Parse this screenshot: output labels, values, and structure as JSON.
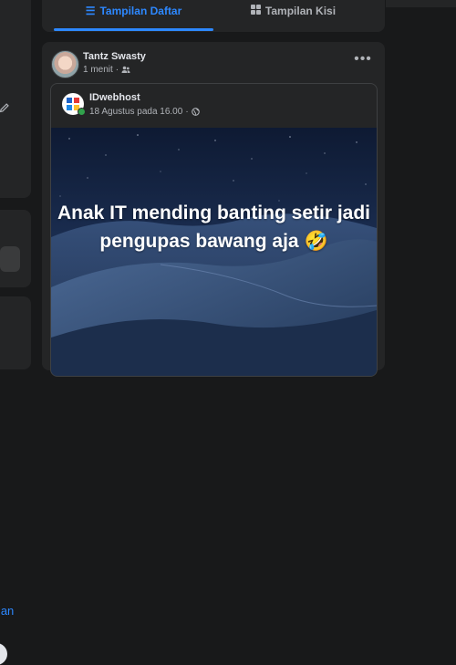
{
  "tabs": {
    "list_view": "Tampilan Daftar",
    "grid_view": "Tampilan Kisi"
  },
  "sidebar": {
    "partial_link": "man"
  },
  "post": {
    "author": "Tantz Swasty",
    "time": "1 menit",
    "privacy_icon": "friends-icon",
    "more_icon": "more-options-icon",
    "shared": {
      "page_name": "IDwebhost",
      "time": "18 Agustus pada 16.00",
      "privacy_icon": "globe-icon",
      "caption": "Anak IT mending banting setir jadi pengupas bawang aja 🤣"
    }
  },
  "colors": {
    "accent": "#2d88ff",
    "card": "#242526",
    "background": "#18191a"
  }
}
